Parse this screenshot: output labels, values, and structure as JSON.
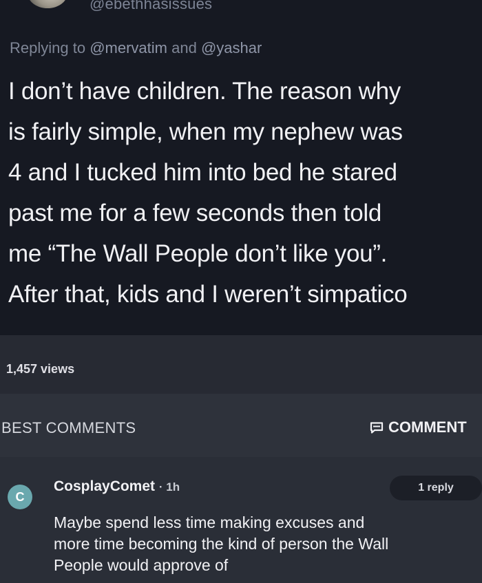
{
  "tweet": {
    "handle": "@ebethhasissues",
    "replying_prefix": "Replying to",
    "mention_1": "@mervatim",
    "and": "and",
    "mention_2": "@yashar",
    "lines": [
      "I don’t have children. The reason why",
      "is fairly simple, when my nephew was",
      "4 and I tucked him into bed he stared",
      "past me for a few seconds then told",
      "me “The Wall People don’t like you”.",
      "After that, kids and I weren’t simpatico"
    ]
  },
  "stats": {
    "views": "1,457 views"
  },
  "comments_header": {
    "title": "BEST COMMENTS",
    "comment_button": "COMMENT",
    "comment_icon": "comment-bubble-icon"
  },
  "comment": {
    "avatar_letter": "C",
    "username": "CosplayComet",
    "time": "· 1h",
    "reply_label": "1 reply",
    "lines": [
      "Maybe spend less time making excuses and",
      "more time becoming the kind of person the Wall",
      "People would approve of"
    ]
  },
  "colors": {
    "background": "#1b1e29",
    "avatar": "#6aa8ae",
    "text": "#f1f1f4",
    "muted": "#7f8696"
  }
}
